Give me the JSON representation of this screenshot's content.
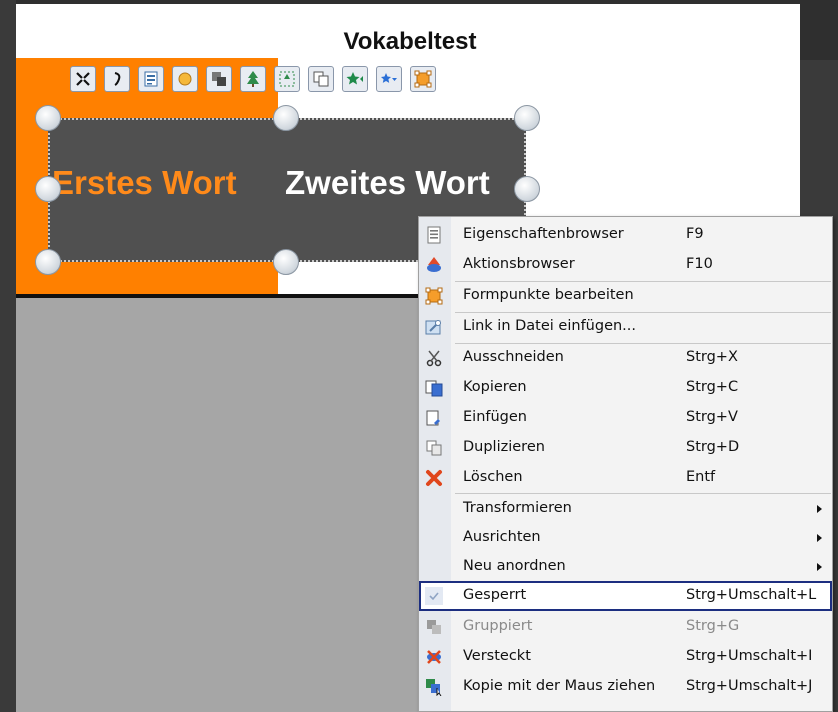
{
  "slide": {
    "title": "Vokabeltest",
    "word_first": "Erstes Wort",
    "word_second": "Zweites Wort"
  },
  "colors": {
    "orange": "#ff8000",
    "textbox": "#505050",
    "selection_border": "#1c2e80"
  },
  "toolbar": {
    "buttons": [
      "fit-icon",
      "bracket-icon",
      "properties-icon",
      "sun-icon",
      "overlap-icon",
      "tree-icon",
      "tree-select-icon",
      "duplicate-icon",
      "star-left-icon",
      "star-down-icon",
      "shape-points-icon"
    ]
  },
  "context_menu": {
    "items": [
      {
        "label": "Eigenschaftenbrowser",
        "shortcut": "F9",
        "icon": "properties-browser-icon"
      },
      {
        "label": "Aktionsbrowser",
        "shortcut": "F10",
        "icon": "action-browser-icon"
      },
      {
        "label": "Formpunkte bearbeiten",
        "shortcut": "",
        "icon": "shape-points-icon"
      },
      {
        "label": "Link in Datei einfügen...",
        "shortcut": "",
        "icon": "link-icon"
      },
      {
        "label": "Ausschneiden",
        "shortcut": "Strg+X",
        "icon": "scissors-icon"
      },
      {
        "label": "Kopieren",
        "shortcut": "Strg+C",
        "icon": "copy-icon"
      },
      {
        "label": "Einfügen",
        "shortcut": "Strg+V",
        "icon": "paste-icon"
      },
      {
        "label": "Duplizieren",
        "shortcut": "Strg+D",
        "icon": "duplicate-icon"
      },
      {
        "label": "Löschen",
        "shortcut": "Entf",
        "icon": "delete-icon"
      },
      {
        "label": "Transformieren",
        "shortcut": "",
        "icon": "",
        "submenu": true
      },
      {
        "label": "Ausrichten",
        "shortcut": "",
        "icon": "",
        "submenu": true
      },
      {
        "label": "Neu anordnen",
        "shortcut": "",
        "icon": "",
        "submenu": true
      },
      {
        "label": "Gesperrt",
        "shortcut": "Strg+Umschalt+L",
        "icon": "check-icon",
        "highlighted": true
      },
      {
        "label": "Gruppiert",
        "shortcut": "Strg+G",
        "icon": "group-icon",
        "disabled": true
      },
      {
        "label": "Versteckt",
        "shortcut": "Strg+Umschalt+I",
        "icon": "hidden-icon"
      },
      {
        "label": "Kopie mit der Maus ziehen",
        "shortcut": "Strg+Umschalt+J",
        "icon": "drag-copy-icon"
      }
    ]
  }
}
